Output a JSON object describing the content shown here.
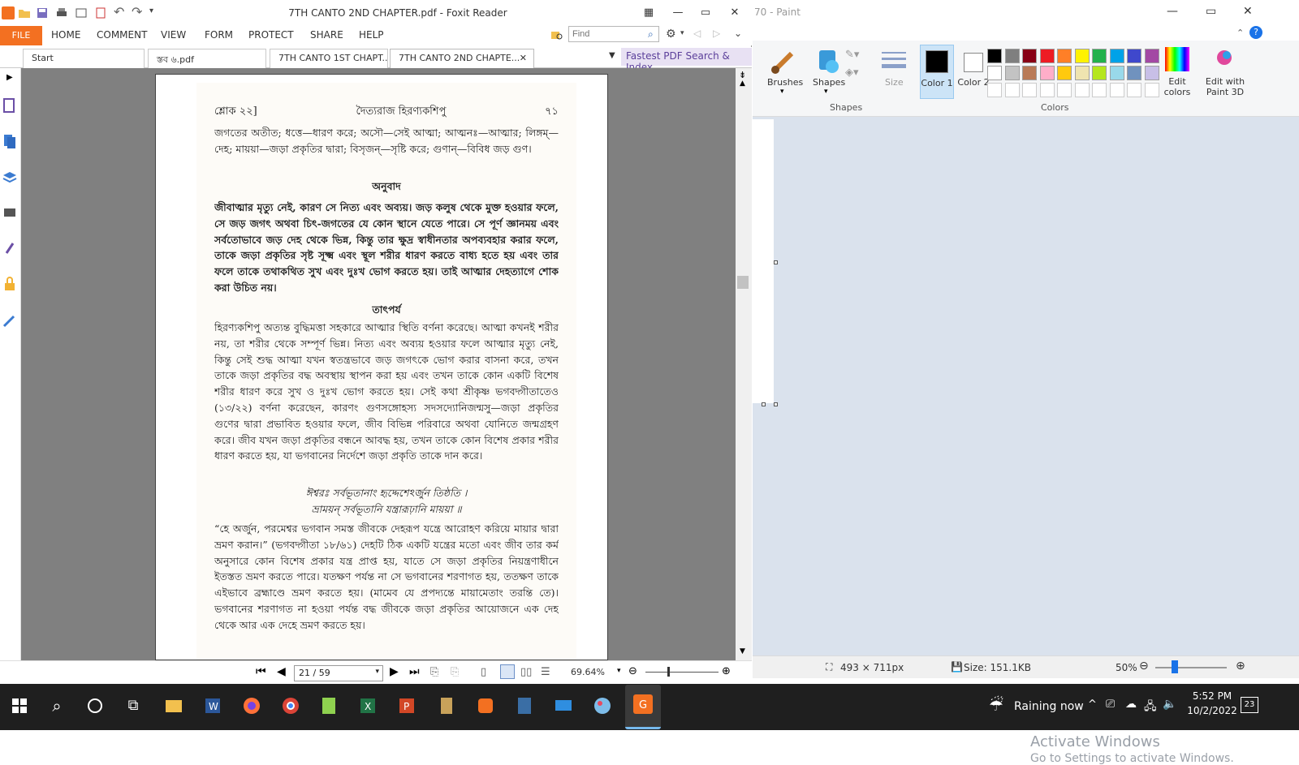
{
  "foxit": {
    "title": "7TH CANTO 2ND CHAPTER.pdf - Foxit Reader",
    "menu": [
      "FILE",
      "HOME",
      "COMMENT",
      "VIEW",
      "FORM",
      "PROTECT",
      "SHARE",
      "HELP"
    ],
    "find_placeholder": "Find",
    "tabs": [
      "Start",
      "স্তব ৬.pdf",
      "7TH CANTO 1ST CHAPT...",
      "7TH CANTO 2ND CHAPTE..."
    ],
    "tab_close": "✕",
    "promo": "Fastest PDF Search & Index",
    "page_box": "21 / 59",
    "zoom": "69.64%",
    "accent": "#f37021"
  },
  "pdf": {
    "header_left": "শ্লোক ২২]",
    "header_center": "দৈত্যরাজ হিরণ্যকশিপু",
    "header_right": "৭১",
    "para1": "জগতের অতীত; ধত্তে—ধারণ করে; অসৌ—সেই আত্মা; আত্মনঃ—আত্মার; লিঙ্গম্‌—দেহ; মায়য়া—জড়া প্রকৃতির দ্বারা; বিসৃজন্‌—সৃষ্টি করে; গুণান্‌—বিবিধ জড় গুণ।",
    "heading_translation": "অনুবাদ",
    "translation": "জীবাত্মার মৃত্যু নেই, কারণ সে নিত্য এবং অব্যয়। জড় কলুষ থেকে মুক্ত হওয়ার ফলে, সে জড় জগৎ অথবা চিৎ-জগতের যে কোন স্থানে যেতে পারে। সে পূর্ণ জ্ঞানময় এবং সর্বতোভাবে জড় দেহ থেকে ভিন্ন, কিন্তু তার ক্ষুদ্র স্বাধীনতার অপব্যবহার করার ফলে, তাকে জড়া প্রকৃতির সৃষ্ট সূক্ষ্ম এবং স্থূল শরীর ধারণ করতে বাধ্য হতে হয় এবং তার ফলে তাকে তথাকথিত সুখ এবং দুঃখ ভোগ করতে হয়। তাই আত্মার দেহত্যাগে শোক করা উচিত নয়।",
    "heading_purport": "তাৎপর্য",
    "purport1": "হিরণ্যকশিপু অত্যন্ত বুদ্ধিমত্তা সহকারে আত্মার স্থিতি বর্ণনা করেছে। আত্মা কখনই শরীর নয়, তা শরীর থেকে সম্পূর্ণ ভিন্ন। নিত্য এবং অব্যয় হওয়ার ফলে আত্মার মৃত্যু নেই, কিন্তু সেই শুদ্ধ আত্মা যখন স্বতন্ত্রভাবে জড় জগৎকে ভোগ করার বাসনা করে, তখন তাকে জড়া প্রকৃতির বদ্ধ অবস্থায় স্থাপন করা হয় এবং তখন তাকে কোন একটি বিশেষ শরীর ধারণ করে সুখ ও দুঃখ ভোগ করতে হয়। সেই কথা শ্রীকৃষ্ণ ভগবদ্গীতাতেও (১৩/২২) বর্ণনা করেছেন, কারণং গুণসঙ্গোহস্য সদসদ্যোনিজন্মসু—জড়া প্রকৃতির গুণের দ্বারা প্রভাবিত হওয়ার ফলে, জীব বিভিন্ন পরিবারে অথবা যোনিতে জন্মগ্রহণ করে। জীব যখন জড়া প্রকৃতির বন্ধনে আবদ্ধ হয়, তখন তাকে কোন বিশেষ প্রকার শরীর ধারণ করতে হয়, যা ভগবানের নির্দেশে জড়া প্রকৃতি তাকে দান করে।",
    "verse1": "ঈশ্বরঃ সর্বভূতানাং হৃদ্দেশেঽর্জুন তিষ্ঠতি ।",
    "verse2": "ভ্রাময়ন্‌ সর্বভূতানি যন্ত্রারূঢ়ানি মায়য়া ॥",
    "purport2": "“হে অর্জুন, পরমেশ্বর ভগবান সমস্ত জীবকে দেহরূপ যন্ত্রে আরোহণ করিয়ে মায়ার দ্বারা ভ্রমণ করান।” (ভগবদ্গীতা ১৮/৬১) দেহটি ঠিক একটি যন্ত্রের মতো এবং জীব তার কর্ম অনুসারে কোন বিশেষ প্রকার যন্ত্র প্রাপ্ত হয়, যাতে সে জড়া প্রকৃতির নিয়ন্ত্রণাধীনে ইতস্তত ভ্রমণ করতে পারে। যতক্ষণ পর্যন্ত না সে ভগবানের শরণাগত হয়, ততক্ষণ তাকে এইভাবে ব্রহ্মাণ্ডে ভ্রমণ করতে হয়। (মামেব যে প্রপদ্যন্তে মায়ামেতাং তরন্তি তে)। ভগবানের শরণাগত না হওয়া পর্যন্ত বদ্ধ জীবকে জড়া প্রকৃতির আয়োজনে এক দেহ থেকে আর এক দেহে ভ্রমণ করতে হয়।"
  },
  "paint": {
    "title": "70 - Paint",
    "tools": {
      "brushes": "Brushes",
      "shapes": "Shapes",
      "size": "Size",
      "color1": "Color 1",
      "color2": "Color 2",
      "edit_colors": "Edit colors",
      "edit_3d": "Edit with Paint 3D"
    },
    "groups": {
      "shapes": "Shapes",
      "colors": "Colors"
    },
    "palette_row1": [
      "#000000",
      "#7f7f7f",
      "#880015",
      "#ed1c24",
      "#ff7f27",
      "#fff200",
      "#22b14c",
      "#00a2e8",
      "#3f48cc",
      "#a349a4"
    ],
    "palette_row2": [
      "#ffffff",
      "#c3c3c3",
      "#b97a57",
      "#ffaec9",
      "#ffc90e",
      "#efe4b0",
      "#b5e61d",
      "#99d9ea",
      "#7092be",
      "#c8bfe7"
    ],
    "dims": "493 × 711px",
    "size": "Size: 151.1KB",
    "zoom": "50%",
    "activate_title": "Activate Windows",
    "activate_sub": "Go to Settings to activate Windows."
  },
  "taskbar": {
    "weather": "Raining now",
    "time": "5:52 PM",
    "date": "10/2/2022",
    "notifications": "23"
  }
}
